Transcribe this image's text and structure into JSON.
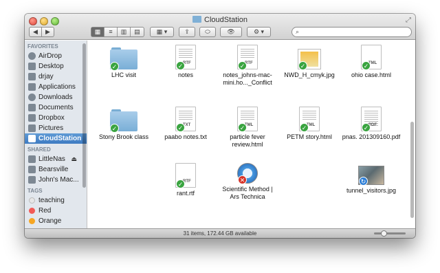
{
  "window": {
    "title": "CloudStation"
  },
  "toolbar": {
    "back": "◀",
    "forward": "▶",
    "views": [
      "▦",
      "≡",
      "▥",
      "▤"
    ],
    "arrange": "▦ ▾",
    "share": "⇪",
    "tag": "⬭",
    "quicklook": "👁",
    "action": "⚙ ▾",
    "search_placeholder": ""
  },
  "sidebar": {
    "favorites_header": "FAVORITES",
    "favorites": [
      {
        "label": "AirDrop",
        "icon": "airdrop-icon"
      },
      {
        "label": "Desktop",
        "icon": "desktop-icon"
      },
      {
        "label": "drjay",
        "icon": "home-icon"
      },
      {
        "label": "Applications",
        "icon": "applications-icon"
      },
      {
        "label": "Downloads",
        "icon": "downloads-icon"
      },
      {
        "label": "Documents",
        "icon": "documents-icon"
      },
      {
        "label": "Dropbox",
        "icon": "folder-icon"
      },
      {
        "label": "Pictures",
        "icon": "pictures-icon"
      },
      {
        "label": "CloudStation",
        "icon": "folder-icon"
      }
    ],
    "shared_header": "SHARED",
    "shared": [
      {
        "label": "LittleNas",
        "icon": "server-icon",
        "eject": "⏏"
      },
      {
        "label": "Bearsville",
        "icon": "server-icon"
      },
      {
        "label": "John's Mac...",
        "icon": "computer-icon"
      }
    ],
    "tags_header": "TAGS",
    "tags": [
      {
        "label": "teaching",
        "color": "#e6e6e6"
      },
      {
        "label": "Red",
        "color": "#f25a56"
      },
      {
        "label": "Orange",
        "color": "#f6a623"
      }
    ]
  },
  "files": [
    {
      "name": "LHC visit",
      "kind": "folder"
    },
    {
      "name": "notes",
      "kind": "doc",
      "ext": "RTF"
    },
    {
      "name": "notes_johns-mac-mini.ho..._Conflict",
      "kind": "doc",
      "ext": "RTF"
    },
    {
      "name": "NWD_H_cmyk.jpg",
      "kind": "image"
    },
    {
      "name": "ohio case.html",
      "kind": "doc",
      "ext": "TML"
    },
    {
      "name": "Stony Brook class",
      "kind": "folder"
    },
    {
      "name": "paabo notes.txt",
      "kind": "doc",
      "ext": "TXT"
    },
    {
      "name": "particle fever review.html",
      "kind": "doc",
      "ext": "TML"
    },
    {
      "name": "PETM story.html",
      "kind": "doc",
      "ext": "TML"
    },
    {
      "name": "pnas. 201309160.pdf",
      "kind": "doc",
      "ext": "PDF"
    },
    {
      "name": "rant.rtf",
      "kind": "doc",
      "ext": "RTF"
    },
    {
      "name": "Scientific Method | Ars Technica",
      "kind": "webloc"
    },
    {
      "name": "tunnel_visitors.jpg",
      "kind": "photo"
    }
  ],
  "badges": {
    "ok": "✓",
    "error": "✕",
    "sync": "↻"
  },
  "status": {
    "text": "31 items, 172.44 GB available"
  }
}
